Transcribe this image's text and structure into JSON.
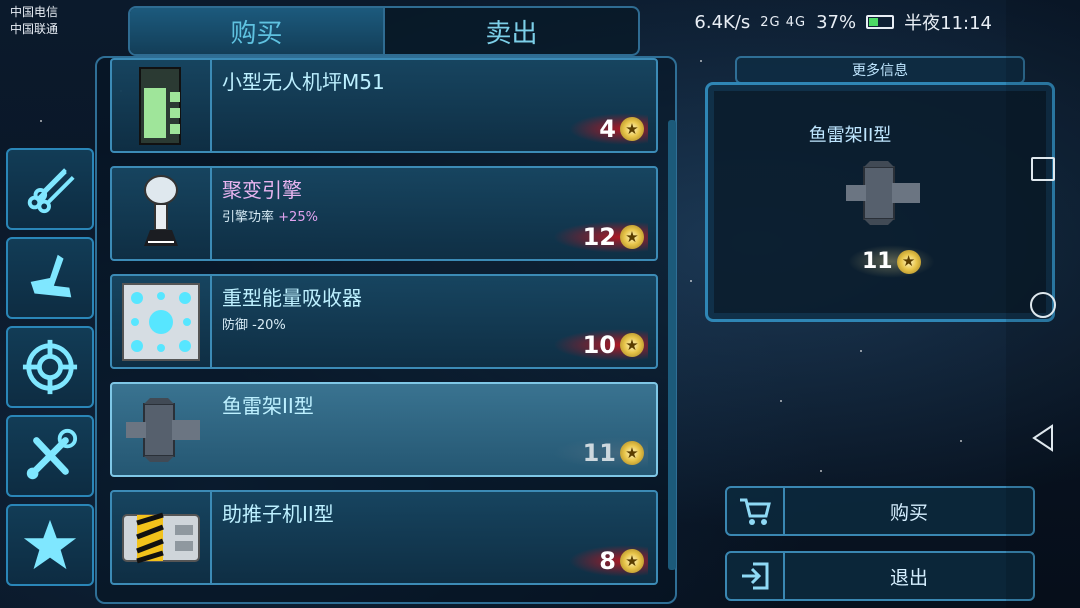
{
  "status": {
    "carrier1": "中国电信",
    "carrier2": "中国联通",
    "speed": "6.4K/s",
    "signal": "2G 4G",
    "battery": "37%",
    "time": "半夜11:14"
  },
  "tabs": [
    {
      "label": "购买",
      "active": true
    },
    {
      "label": "卖出",
      "active": false
    }
  ],
  "categories": [
    "materials-icon",
    "hull-icon",
    "target-icon",
    "tools-icon",
    "star-icon"
  ],
  "items": [
    {
      "name": "小型无人机坪M51",
      "stat": "",
      "stat_value": "",
      "price": "4"
    },
    {
      "name": "聚变引擎",
      "stat": "引擎功率",
      "stat_value": "+25%",
      "price": "12"
    },
    {
      "name": "重型能量吸收器",
      "stat": "防御",
      "stat_value": "-20%",
      "price": "10"
    },
    {
      "name": "鱼雷架II型",
      "stat": "",
      "stat_value": "",
      "price": "11"
    },
    {
      "name": "助推子机II型",
      "stat": "",
      "stat_value": "",
      "price": "8"
    }
  ],
  "detail": {
    "header": "更多信息",
    "title": "鱼雷架II型",
    "price": "11"
  },
  "actions": {
    "buy": "购买",
    "exit": "退出"
  },
  "colors": {
    "accent": "#2f86b5",
    "price_glow": "#c8141e",
    "coin": "#e8c54a"
  }
}
